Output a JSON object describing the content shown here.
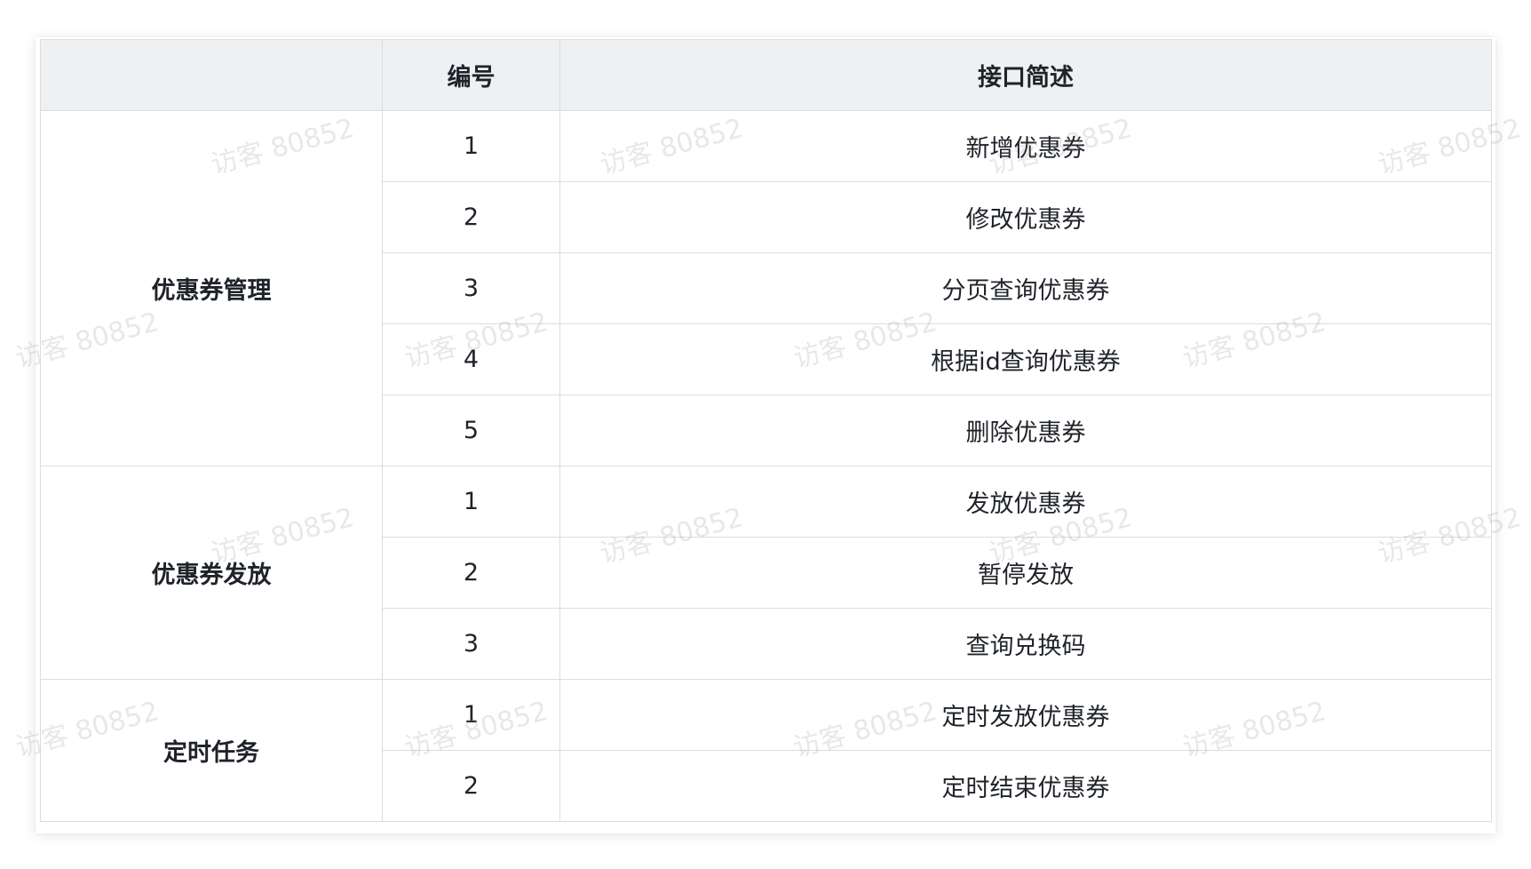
{
  "table": {
    "headers": [
      "",
      "编号",
      "接口简述"
    ],
    "groups": [
      {
        "name": "优惠券管理",
        "rows": [
          {
            "num": "1",
            "desc": "新增优惠券"
          },
          {
            "num": "2",
            "desc": "修改优惠券"
          },
          {
            "num": "3",
            "desc": "分页查询优惠券"
          },
          {
            "num": "4",
            "desc": "根据id查询优惠券"
          },
          {
            "num": "5",
            "desc": "删除优惠券"
          }
        ]
      },
      {
        "name": "优惠券发放",
        "rows": [
          {
            "num": "1",
            "desc": "发放优惠券"
          },
          {
            "num": "2",
            "desc": "暂停发放"
          },
          {
            "num": "3",
            "desc": "查询兑换码"
          }
        ]
      },
      {
        "name": "定时任务",
        "rows": [
          {
            "num": "1",
            "desc": "定时发放优惠券"
          },
          {
            "num": "2",
            "desc": "定时结束优惠券"
          }
        ]
      }
    ]
  },
  "watermark": {
    "text": "访客 80852"
  },
  "colors": {
    "header_bg": "#eff0f1",
    "border": "#d9dde3",
    "text": "#1f2329"
  }
}
